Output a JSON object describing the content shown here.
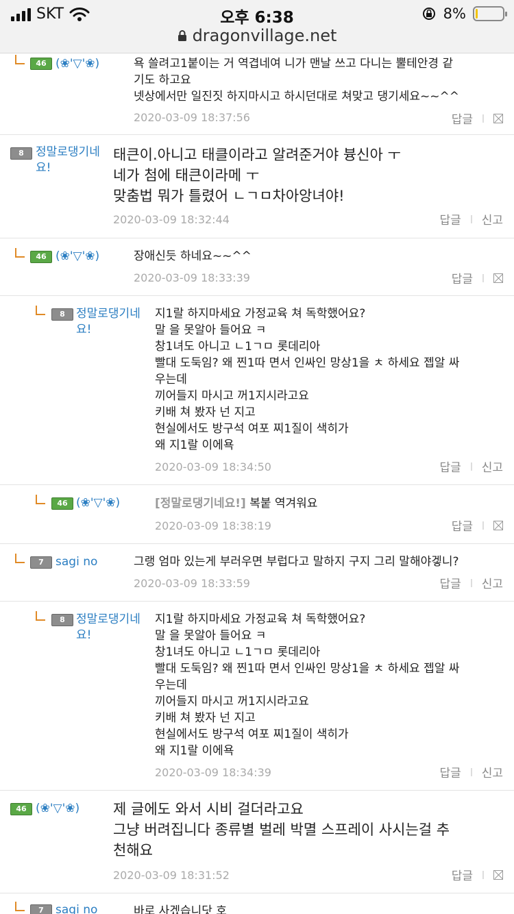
{
  "status": {
    "carrier": "SKT",
    "time": "오후 6:38",
    "battery_text": "8%",
    "battery_level": 0.08,
    "url": "dragonvillage.net"
  },
  "labels": {
    "reply": "답글",
    "report": "신고"
  },
  "comments": [
    {
      "level": "46",
      "nick": "(❀'▽'❀)",
      "lines": [
        "욕 쓸려고1붙이는 거 역겹네여 니가 맨날 쓰고 다니는 뿔테안경 같",
        "기도 하고요",
        "넷상에서만 일진짓 하지마시고 하시던대로 쳐맞고 댕기세요~~^^"
      ],
      "date": "2020-03-09 18:37:56"
    },
    {
      "level": "8",
      "nick": "정말로댕기네요!",
      "lines": [
        "태큰이.아니고 태클이라고 알려준거야 븅신아 ㅜ",
        "네가 첨에 태큰이라메 ㅜ",
        "맞춤법 뭐가 틀렸어 ㄴㄱㅁ차아앙녀야!"
      ],
      "date": "2020-03-09 18:32:44"
    },
    {
      "level": "46",
      "nick": "(❀'▽'❀)",
      "lines": [
        "장애신듯 하네요~~^^"
      ],
      "date": "2020-03-09 18:33:39"
    },
    {
      "level": "8",
      "nick": "정말로댕기네요!",
      "lines": [
        "지1랄 하지마세요 가정교육 쳐 독학했어요?",
        "말 을 못알아 들어요 ㅋ",
        "창1녀도 아니고 ㄴ1ㄱㅁ 롯데리아",
        "빨대 도둑임? 왜 찐1따 면서 인싸인 망상1을 ㅊ 하세요 젭알 싸",
        "우는데",
        "끼어들지 마시고 꺼1지시라고요",
        "키배 쳐 봤자 넌 지고",
        "현실에서도 방구석 여포 찌1질이 색히가",
        "왜 지1랄 이에욕"
      ],
      "date": "2020-03-09 18:34:50"
    },
    {
      "level": "46",
      "nick": "(❀'▽'❀)",
      "ref": "[정말로댕기네요!]",
      "lines": [
        "복붙 역겨워요"
      ],
      "date": "2020-03-09 18:38:19"
    },
    {
      "level": "7",
      "nick": "sagi no",
      "lines": [
        "그랭 엄마 있는게 부러우면 부럽다고 말하지 구지 그리 말해야겧니?"
      ],
      "date": "2020-03-09 18:33:59"
    },
    {
      "level": "8",
      "nick": "정말로댕기네요!",
      "lines": [
        "지1랄 하지마세요 가정교육 쳐 독학했어요?",
        "말 을 못알아 들어요 ㅋ",
        "창1녀도 아니고 ㄴ1ㄱㅁ 롯데리아",
        "빨대 도둑임? 왜 찐1따 면서 인싸인 망상1을 ㅊ 하세요 젭알 싸",
        "우는데",
        "끼어들지 마시고 꺼1지시라고요",
        "키배 쳐 봤자 넌 지고",
        "현실에서도 방구석 여포 찌1질이 색히가",
        "왜 지1랄 이에욕"
      ],
      "date": "2020-03-09 18:34:39"
    },
    {
      "level": "46",
      "nick": "(❀'▽'❀)",
      "lines": [
        "제 글에도 와서 시비 걸더라고요",
        "그냥 버려집니다 종류별 벌레 박멸 스프레이 사시는걸 추",
        "천해요"
      ],
      "date": "2020-03-09 18:31:52"
    },
    {
      "level": "7",
      "nick": "sagi no",
      "lines": [
        "바로 사겠습니닷 호"
      ],
      "date": ""
    }
  ]
}
